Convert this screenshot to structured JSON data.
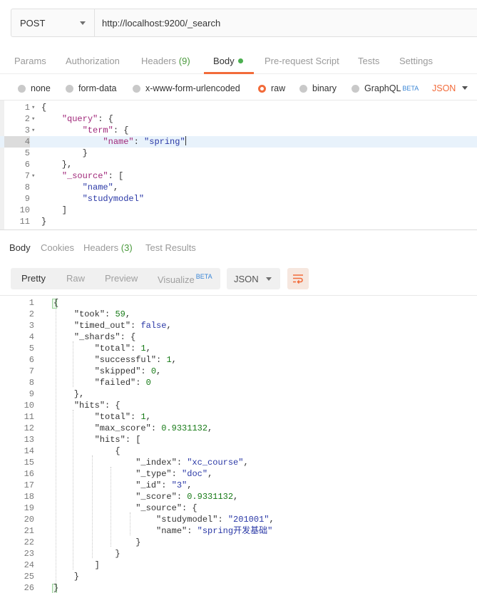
{
  "request": {
    "method": "POST",
    "url": "http://localhost:9200/_search"
  },
  "request_tabs": [
    {
      "label": "Params"
    },
    {
      "label": "Authorization"
    },
    {
      "label": "Headers",
      "count": "(9)"
    },
    {
      "label": "Body",
      "active": true
    },
    {
      "label": "Pre-request Script"
    },
    {
      "label": "Tests"
    },
    {
      "label": "Settings"
    }
  ],
  "body_options": [
    {
      "label": "none"
    },
    {
      "label": "form-data"
    },
    {
      "label": "x-www-form-urlencoded"
    },
    {
      "label": "raw",
      "selected": true
    },
    {
      "label": "binary"
    },
    {
      "label": "GraphQL",
      "badge": "BETA"
    }
  ],
  "body_format": "JSON",
  "request_body": {
    "highlighted_line": 4,
    "lines": [
      {
        "num": "1",
        "fold": "▾",
        "tokens": [
          {
            "t": "{",
            "c": "p"
          }
        ]
      },
      {
        "num": "2",
        "fold": "▾",
        "tokens": [
          {
            "t": "    ",
            "c": "p"
          },
          {
            "t": "\"query\"",
            "c": "k"
          },
          {
            "t": ": {",
            "c": "p"
          }
        ]
      },
      {
        "num": "3",
        "fold": "▾",
        "tokens": [
          {
            "t": "        ",
            "c": "p"
          },
          {
            "t": "\"term\"",
            "c": "k"
          },
          {
            "t": ": {",
            "c": "p"
          }
        ]
      },
      {
        "num": "4",
        "fold": "",
        "tokens": [
          {
            "t": "            ",
            "c": "p"
          },
          {
            "t": "\"name\"",
            "c": "k"
          },
          {
            "t": ": ",
            "c": "p"
          },
          {
            "t": "\"spring\"",
            "c": "s"
          }
        ]
      },
      {
        "num": "5",
        "fold": "",
        "tokens": [
          {
            "t": "        }",
            "c": "p"
          }
        ]
      },
      {
        "num": "6",
        "fold": "",
        "tokens": [
          {
            "t": "    },",
            "c": "p"
          }
        ]
      },
      {
        "num": "7",
        "fold": "▾",
        "tokens": [
          {
            "t": "    ",
            "c": "p"
          },
          {
            "t": "\"_source\"",
            "c": "k"
          },
          {
            "t": ": [",
            "c": "p"
          }
        ]
      },
      {
        "num": "8",
        "fold": "",
        "tokens": [
          {
            "t": "        ",
            "c": "p"
          },
          {
            "t": "\"name\"",
            "c": "s"
          },
          {
            "t": ",",
            "c": "p"
          }
        ]
      },
      {
        "num": "9",
        "fold": "",
        "tokens": [
          {
            "t": "        ",
            "c": "p"
          },
          {
            "t": "\"studymodel\"",
            "c": "s"
          }
        ]
      },
      {
        "num": "10",
        "fold": "",
        "tokens": [
          {
            "t": "    ]",
            "c": "p"
          }
        ]
      },
      {
        "num": "11",
        "fold": "",
        "tokens": [
          {
            "t": "}",
            "c": "p"
          }
        ]
      }
    ]
  },
  "response_tabs": [
    {
      "label": "Body",
      "active": true
    },
    {
      "label": "Cookies"
    },
    {
      "label": "Headers",
      "count": "(3)"
    },
    {
      "label": "Test Results"
    }
  ],
  "response_views": [
    {
      "label": "Pretty",
      "active": true
    },
    {
      "label": "Raw"
    },
    {
      "label": "Preview"
    },
    {
      "label": "Visualize",
      "badge": "BETA"
    }
  ],
  "response_format": "JSON",
  "response_body": {
    "lines": [
      {
        "num": "1",
        "tokens": [
          {
            "t": "{",
            "c": "box"
          }
        ]
      },
      {
        "num": "2",
        "tokens": [
          {
            "t": "    ",
            "c": "p"
          },
          {
            "t": "\"took\"",
            "c": "p"
          },
          {
            "t": ": ",
            "c": "p"
          },
          {
            "t": "59",
            "c": "n"
          },
          {
            "t": ",",
            "c": "p"
          }
        ]
      },
      {
        "num": "3",
        "tokens": [
          {
            "t": "    ",
            "c": "p"
          },
          {
            "t": "\"timed_out\"",
            "c": "p"
          },
          {
            "t": ": ",
            "c": "p"
          },
          {
            "t": "false",
            "c": "b"
          },
          {
            "t": ",",
            "c": "p"
          }
        ]
      },
      {
        "num": "4",
        "tokens": [
          {
            "t": "    ",
            "c": "p"
          },
          {
            "t": "\"_shards\"",
            "c": "p"
          },
          {
            "t": ": {",
            "c": "p"
          }
        ]
      },
      {
        "num": "5",
        "tokens": [
          {
            "t": "        ",
            "c": "p"
          },
          {
            "t": "\"total\"",
            "c": "p"
          },
          {
            "t": ": ",
            "c": "p"
          },
          {
            "t": "1",
            "c": "n"
          },
          {
            "t": ",",
            "c": "p"
          }
        ]
      },
      {
        "num": "6",
        "tokens": [
          {
            "t": "        ",
            "c": "p"
          },
          {
            "t": "\"successful\"",
            "c": "p"
          },
          {
            "t": ": ",
            "c": "p"
          },
          {
            "t": "1",
            "c": "n"
          },
          {
            "t": ",",
            "c": "p"
          }
        ]
      },
      {
        "num": "7",
        "tokens": [
          {
            "t": "        ",
            "c": "p"
          },
          {
            "t": "\"skipped\"",
            "c": "p"
          },
          {
            "t": ": ",
            "c": "p"
          },
          {
            "t": "0",
            "c": "n"
          },
          {
            "t": ",",
            "c": "p"
          }
        ]
      },
      {
        "num": "8",
        "tokens": [
          {
            "t": "        ",
            "c": "p"
          },
          {
            "t": "\"failed\"",
            "c": "p"
          },
          {
            "t": ": ",
            "c": "p"
          },
          {
            "t": "0",
            "c": "n"
          }
        ]
      },
      {
        "num": "9",
        "tokens": [
          {
            "t": "    },",
            "c": "p"
          }
        ]
      },
      {
        "num": "10",
        "tokens": [
          {
            "t": "    ",
            "c": "p"
          },
          {
            "t": "\"hits\"",
            "c": "p"
          },
          {
            "t": ": {",
            "c": "p"
          }
        ]
      },
      {
        "num": "11",
        "tokens": [
          {
            "t": "        ",
            "c": "p"
          },
          {
            "t": "\"total\"",
            "c": "p"
          },
          {
            "t": ": ",
            "c": "p"
          },
          {
            "t": "1",
            "c": "n"
          },
          {
            "t": ",",
            "c": "p"
          }
        ]
      },
      {
        "num": "12",
        "tokens": [
          {
            "t": "        ",
            "c": "p"
          },
          {
            "t": "\"max_score\"",
            "c": "p"
          },
          {
            "t": ": ",
            "c": "p"
          },
          {
            "t": "0.9331132",
            "c": "n"
          },
          {
            "t": ",",
            "c": "p"
          }
        ]
      },
      {
        "num": "13",
        "tokens": [
          {
            "t": "        ",
            "c": "p"
          },
          {
            "t": "\"hits\"",
            "c": "p"
          },
          {
            "t": ": [",
            "c": "p"
          }
        ]
      },
      {
        "num": "14",
        "tokens": [
          {
            "t": "            {",
            "c": "p"
          }
        ]
      },
      {
        "num": "15",
        "tokens": [
          {
            "t": "                ",
            "c": "p"
          },
          {
            "t": "\"_index\"",
            "c": "p"
          },
          {
            "t": ": ",
            "c": "p"
          },
          {
            "t": "\"xc_course\"",
            "c": "s"
          },
          {
            "t": ",",
            "c": "p"
          }
        ]
      },
      {
        "num": "16",
        "tokens": [
          {
            "t": "                ",
            "c": "p"
          },
          {
            "t": "\"_type\"",
            "c": "p"
          },
          {
            "t": ": ",
            "c": "p"
          },
          {
            "t": "\"doc\"",
            "c": "s"
          },
          {
            "t": ",",
            "c": "p"
          }
        ]
      },
      {
        "num": "17",
        "tokens": [
          {
            "t": "                ",
            "c": "p"
          },
          {
            "t": "\"_id\"",
            "c": "p"
          },
          {
            "t": ": ",
            "c": "p"
          },
          {
            "t": "\"3\"",
            "c": "s"
          },
          {
            "t": ",",
            "c": "p"
          }
        ]
      },
      {
        "num": "18",
        "tokens": [
          {
            "t": "                ",
            "c": "p"
          },
          {
            "t": "\"_score\"",
            "c": "p"
          },
          {
            "t": ": ",
            "c": "p"
          },
          {
            "t": "0.9331132",
            "c": "n"
          },
          {
            "t": ",",
            "c": "p"
          }
        ]
      },
      {
        "num": "19",
        "tokens": [
          {
            "t": "                ",
            "c": "p"
          },
          {
            "t": "\"_source\"",
            "c": "p"
          },
          {
            "t": ": {",
            "c": "p"
          }
        ]
      },
      {
        "num": "20",
        "tokens": [
          {
            "t": "                    ",
            "c": "p"
          },
          {
            "t": "\"studymodel\"",
            "c": "p"
          },
          {
            "t": ": ",
            "c": "p"
          },
          {
            "t": "\"201001\"",
            "c": "s"
          },
          {
            "t": ",",
            "c": "p"
          }
        ]
      },
      {
        "num": "21",
        "tokens": [
          {
            "t": "                    ",
            "c": "p"
          },
          {
            "t": "\"name\"",
            "c": "p"
          },
          {
            "t": ": ",
            "c": "p"
          },
          {
            "t": "\"spring开发基础\"",
            "c": "s"
          }
        ]
      },
      {
        "num": "22",
        "tokens": [
          {
            "t": "                }",
            "c": "p"
          }
        ]
      },
      {
        "num": "23",
        "tokens": [
          {
            "t": "            }",
            "c": "p"
          }
        ]
      },
      {
        "num": "24",
        "tokens": [
          {
            "t": "        ]",
            "c": "p"
          }
        ]
      },
      {
        "num": "25",
        "tokens": [
          {
            "t": "    }",
            "c": "p"
          }
        ]
      },
      {
        "num": "26",
        "tokens": [
          {
            "t": "}",
            "c": "box"
          }
        ]
      }
    ]
  },
  "colors": {
    "accent": "#f26b3a",
    "count_green": "#4a9a3c",
    "key_purple": "#a0287a",
    "string_blue": "#2a38a6",
    "number_green": "#177a17"
  },
  "icons": {
    "method_dropdown": "chevron-down-icon",
    "format_dropdown": "chevron-down-icon",
    "wrap": "wrap-lines-icon"
  }
}
